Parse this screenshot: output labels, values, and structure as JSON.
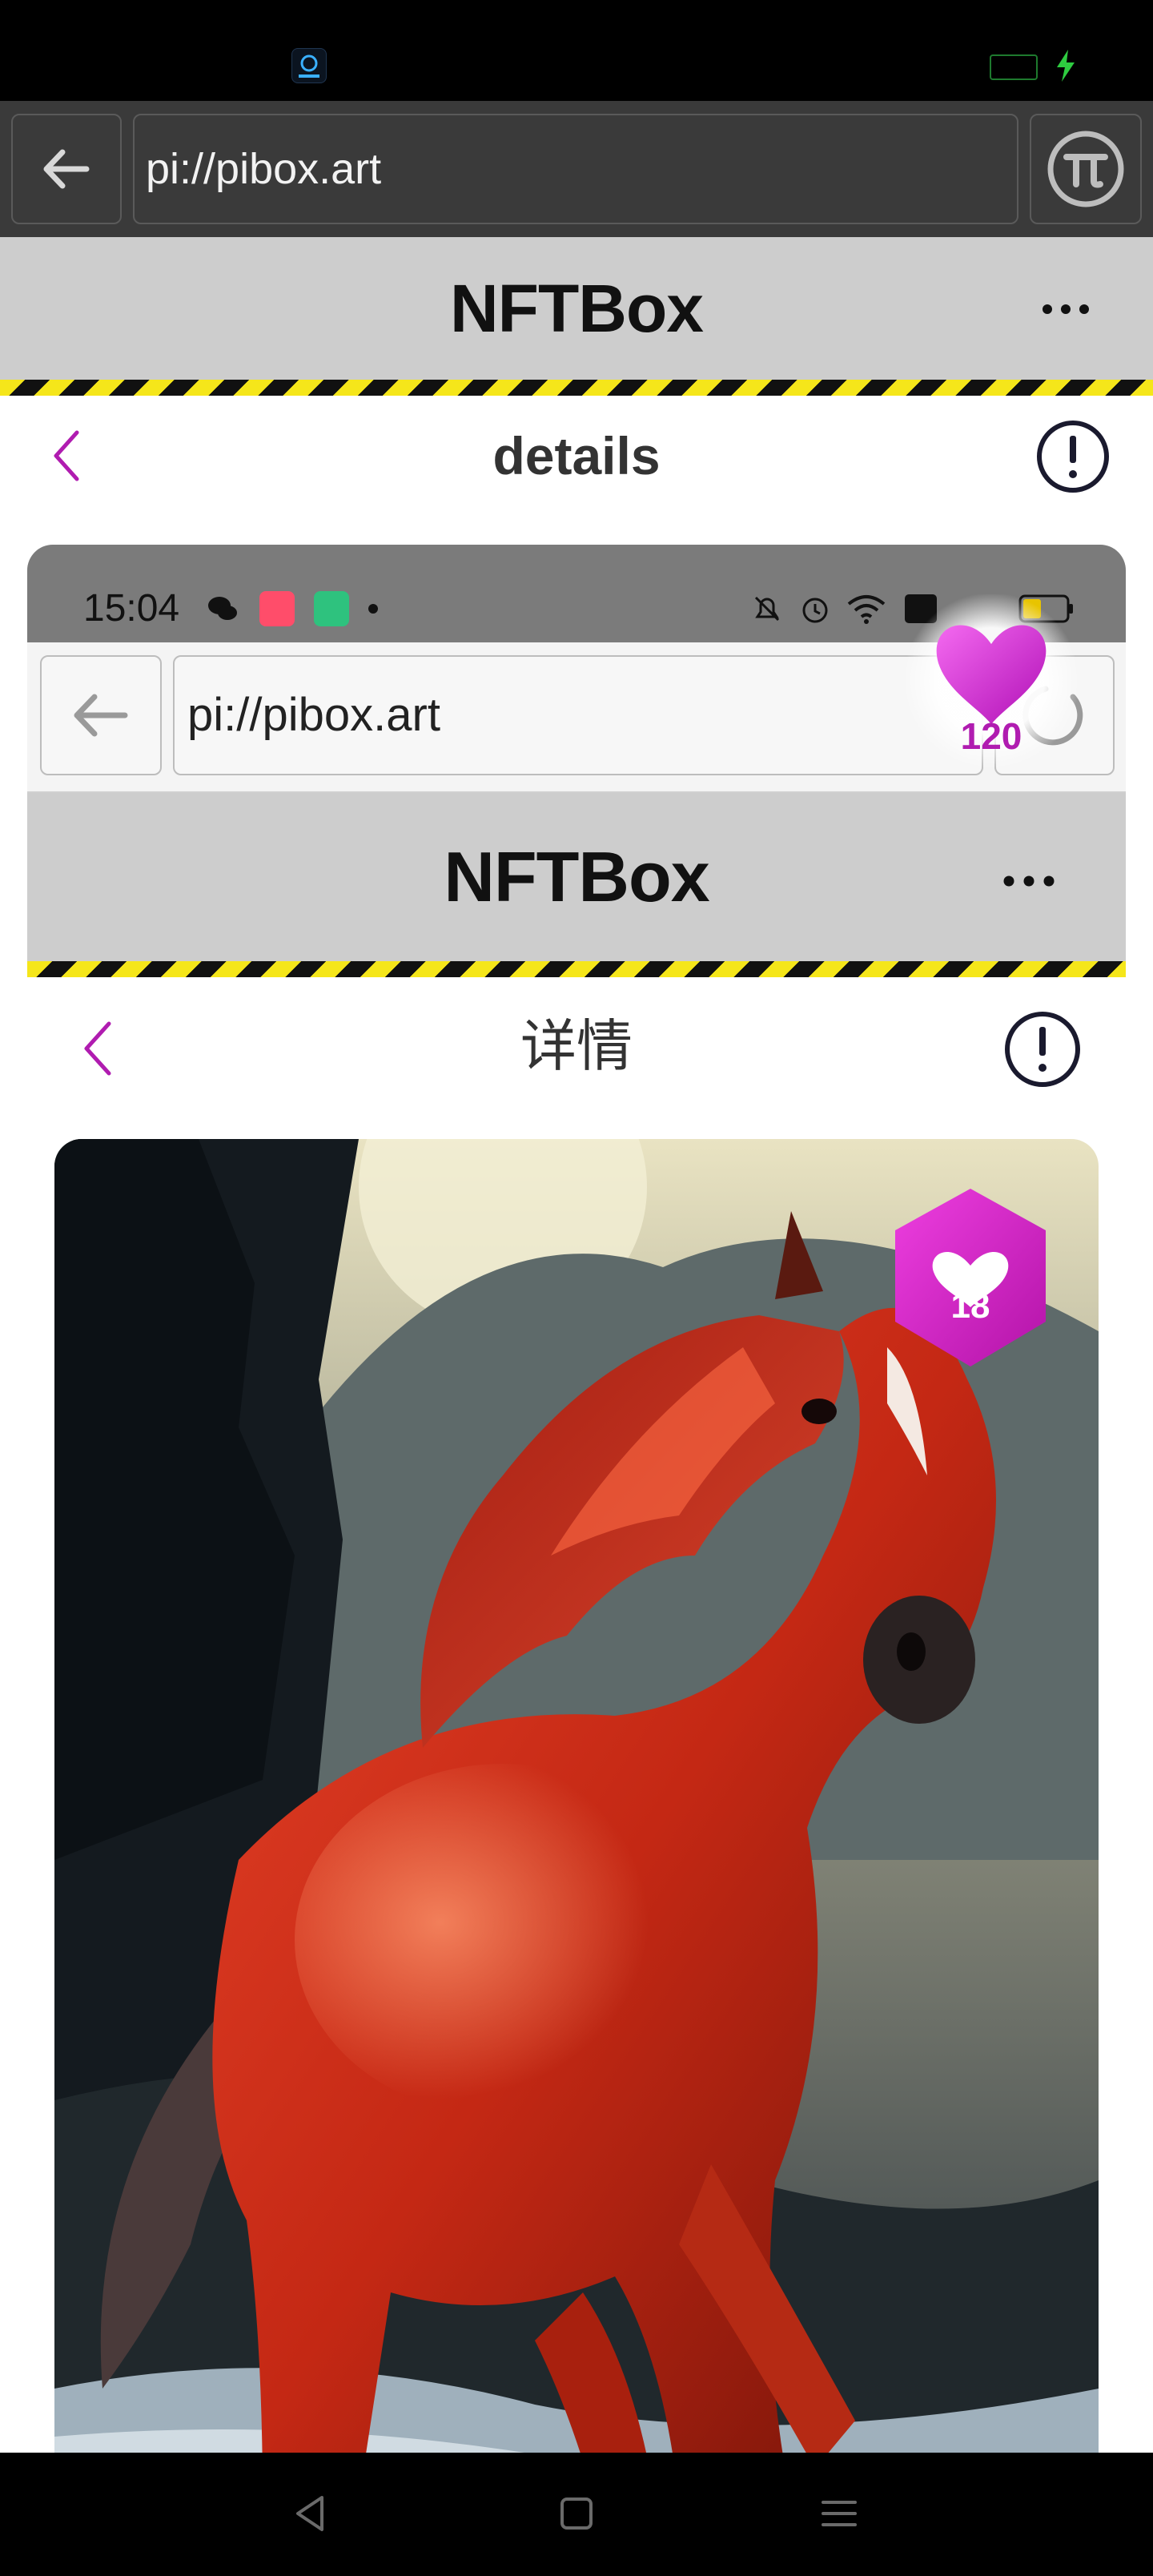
{
  "browser": {
    "url": "pi://pibox.art"
  },
  "app": {
    "title": "NFTBox"
  },
  "details_nav": {
    "title": "details"
  },
  "embedded_screenshot": {
    "status_time": "15:04",
    "url": "pi://pibox.art",
    "app_title": "NFTBox",
    "nav_title": "详情",
    "like_count": "18"
  },
  "floating_like": {
    "count": "120"
  },
  "colors": {
    "accent": "#b01cb0",
    "stripe_yellow": "#f5e61a",
    "header_gray": "#cdcdcd"
  },
  "icons": [
    "back-arrow-icon",
    "pi-logo-icon",
    "more-icon",
    "chevron-left-icon",
    "info-icon",
    "heart-icon",
    "wechat-icon",
    "alarm-icon",
    "wifi-icon",
    "battery-icon"
  ]
}
